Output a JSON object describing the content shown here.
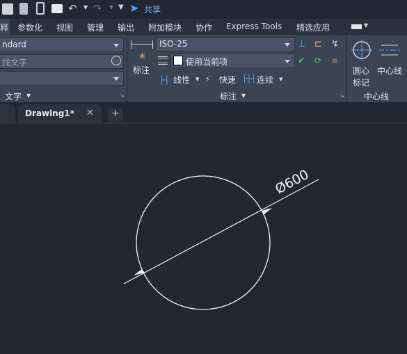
{
  "qat": {
    "share_label": "共享"
  },
  "tabs": [
    {
      "label": "释"
    },
    {
      "label": "参数化"
    },
    {
      "label": "视图"
    },
    {
      "label": "管理"
    },
    {
      "label": "输出"
    },
    {
      "label": "附加模块"
    },
    {
      "label": "协作"
    },
    {
      "label": "Express Tools"
    },
    {
      "label": "精选应用"
    }
  ],
  "text_panel": {
    "style_value": "ndard",
    "search_placeholder": "找文字",
    "panel_label": "文字"
  },
  "dim_panel": {
    "dim_button": "标注",
    "dimstyle_value": "ISO-25",
    "layer_value": "使用当前项",
    "linear": "线性",
    "quick": "快速",
    "continue": "连续",
    "panel_label": "标注"
  },
  "center_panel": {
    "center_mark": "圆心\n标记",
    "center_mark_l1": "圆心",
    "center_mark_l2": "标记",
    "centerline": "中心线",
    "panel_label": "中心线"
  },
  "doc": {
    "tab_label": "Drawing1*",
    "new_tab": "+",
    "close": "✕"
  },
  "drawing": {
    "dimension_text": "Ø600"
  },
  "colors": {
    "accent": "#4aa8ff",
    "background": "#212830",
    "ribbon": "#3b4453"
  }
}
